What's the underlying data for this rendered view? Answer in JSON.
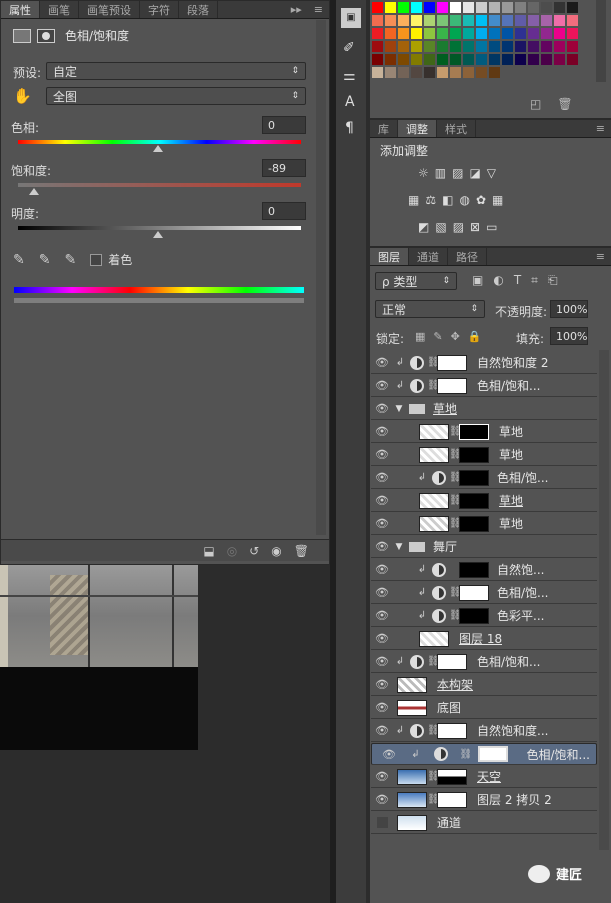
{
  "properties_panel": {
    "tabs": [
      "属性",
      "画笔",
      "画笔预设",
      "字符",
      "段落"
    ],
    "title": "色相/饱和度",
    "preset_label": "预设:",
    "preset_value": "自定",
    "channel_value": "全图",
    "hue_label": "色相:",
    "hue_value": "0",
    "saturation_label": "饱和度:",
    "saturation_value": "-89",
    "lightness_label": "明度:",
    "lightness_value": "0",
    "colorize_label": "着色"
  },
  "adjustments_panel": {
    "tabs": [
      "库",
      "调整",
      "样式"
    ],
    "title": "添加调整"
  },
  "layers_panel": {
    "tabs": [
      "图层",
      "通道",
      "路径"
    ],
    "filter_kind": "ρ 类型",
    "blend_mode": "正常",
    "opacity_label": "不透明度:",
    "opacity_value": "100%",
    "lock_label": "锁定:",
    "fill_label": "填充:",
    "fill_value": "100%",
    "layers": [
      {
        "name": "自然饱和度 2"
      },
      {
        "name": "色相/饱和..."
      },
      {
        "name": "草地"
      },
      {
        "name": "草地"
      },
      {
        "name": "草地"
      },
      {
        "name": "色相/饱..."
      },
      {
        "name": "草地"
      },
      {
        "name": "草地"
      },
      {
        "name": "舞厅"
      },
      {
        "name": "自然饱..."
      },
      {
        "name": "色相/饱..."
      },
      {
        "name": "色彩平..."
      },
      {
        "name": "图层 18"
      },
      {
        "name": "色相/饱和..."
      },
      {
        "name": "本构架"
      },
      {
        "name": "底图"
      },
      {
        "name": "自然饱和度..."
      },
      {
        "name": "色相/饱和..."
      },
      {
        "name": "天空"
      },
      {
        "name": "图层 2 拷贝 2"
      },
      {
        "name": "通道"
      }
    ]
  },
  "watermark": "建匠",
  "colors": {
    "panel": "#535353",
    "selected_row": "#5a6b84",
    "accent": "#2ec7ff"
  }
}
